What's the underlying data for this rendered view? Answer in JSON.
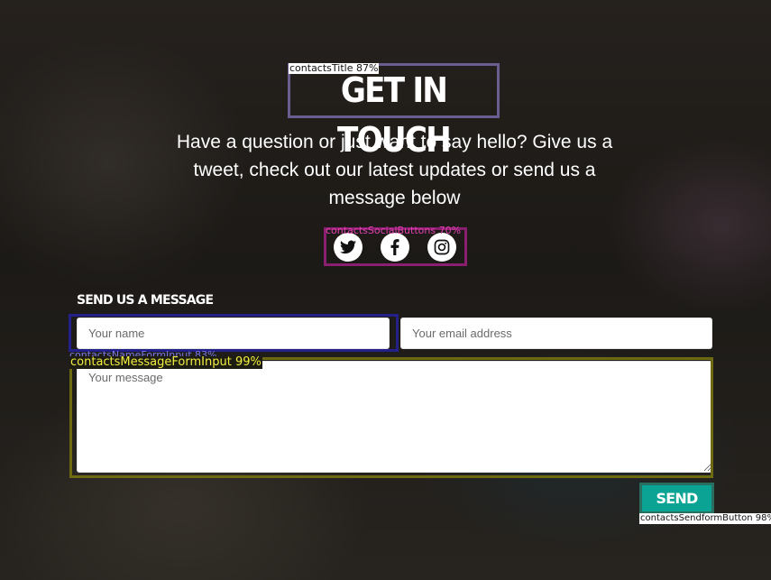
{
  "contacts": {
    "title": "GET IN TOUCH",
    "subtitle": "Have a question or just want to say hello? Give us a tweet, check out our latest updates or send us a message below",
    "social": [
      {
        "icon": "twitter-icon"
      },
      {
        "icon": "facebook-icon"
      },
      {
        "icon": "instagram-icon"
      }
    ],
    "form": {
      "heading": "SEND US A MESSAGE",
      "name_placeholder": "Your name",
      "email_placeholder": "Your email address",
      "message_placeholder": "Your message",
      "send_label": "SEND"
    }
  },
  "annotations": {
    "title": "contactsTitle 87%",
    "social": "contactsSocialButtons 70%",
    "name_input": "contactsNameFormInput 83%",
    "message_input": "contactsMessageFormInput 99%",
    "send_button": "contactsSendformButton 98%"
  },
  "colors": {
    "accent": "#0aa394",
    "ann_title": "#6b5d8f",
    "ann_social": "#8a1f6f",
    "ann_name": "#24208a",
    "ann_message": "#6e6a12",
    "ann_send": "#2a6e60"
  }
}
